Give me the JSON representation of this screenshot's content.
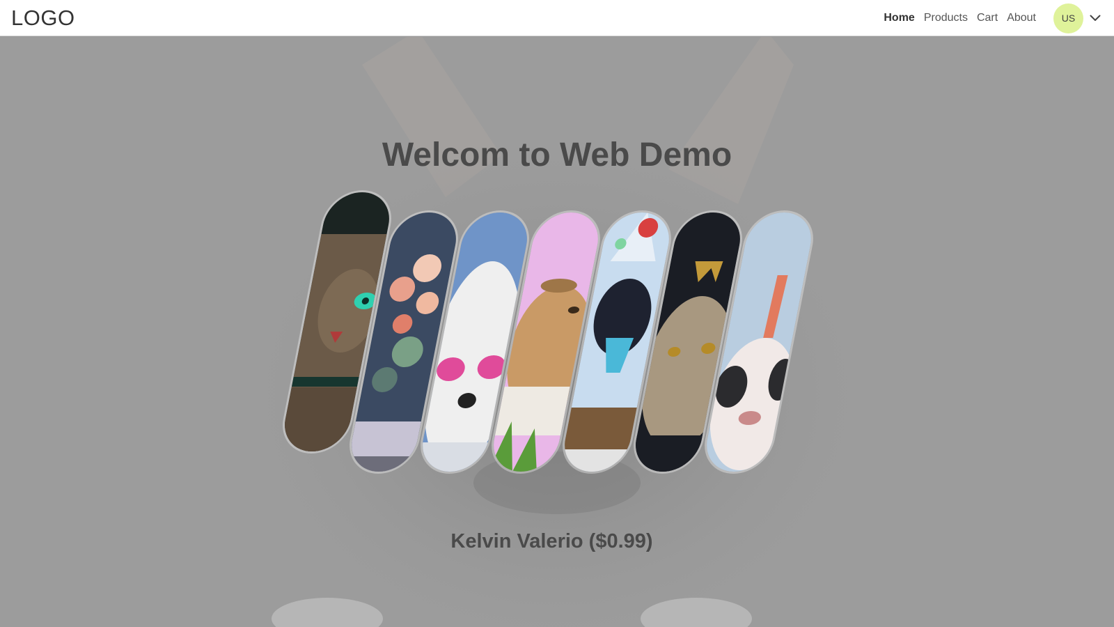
{
  "brand": {
    "logo": "LOGO"
  },
  "nav": {
    "links": [
      {
        "label": "Home",
        "active": true
      },
      {
        "label": "Products",
        "active": false
      },
      {
        "label": "Cart",
        "active": false
      },
      {
        "label": "About",
        "active": false
      }
    ],
    "avatar_initials": "US",
    "avatar_color": "#dff29a",
    "menu_icon": "chevron-down-icon"
  },
  "hero": {
    "title": "Welcom to Web Demo",
    "caption": "Kelvin Valerio ($0.99)"
  },
  "carousel": {
    "slides": [
      {
        "subject": "tabby-cat",
        "colors": [
          "#1c2624",
          "#6b5a48",
          "#2fd0b0"
        ],
        "raised": true
      },
      {
        "subject": "flowers",
        "colors": [
          "#3b4a62",
          "#e8a08c",
          "#f2c9b5"
        ]
      },
      {
        "subject": "white-dog-sunglasses",
        "colors": [
          "#6f94c8",
          "#f0f0f0",
          "#e04b9a"
        ]
      },
      {
        "subject": "dog-pink-bg",
        "colors": [
          "#e9b7e8",
          "#c99a66",
          "#5a9c3a"
        ]
      },
      {
        "subject": "puppy-party-hat",
        "colors": [
          "#c8dcef",
          "#1e2230",
          "#4ab8d8"
        ]
      },
      {
        "subject": "cat-crown",
        "colors": [
          "#1a1d24",
          "#a89880",
          "#c39a3a"
        ]
      },
      {
        "subject": "bulldog-bunny-ears",
        "colors": [
          "#b9cde0",
          "#f1e9e7",
          "#e27a5e"
        ]
      }
    ]
  }
}
